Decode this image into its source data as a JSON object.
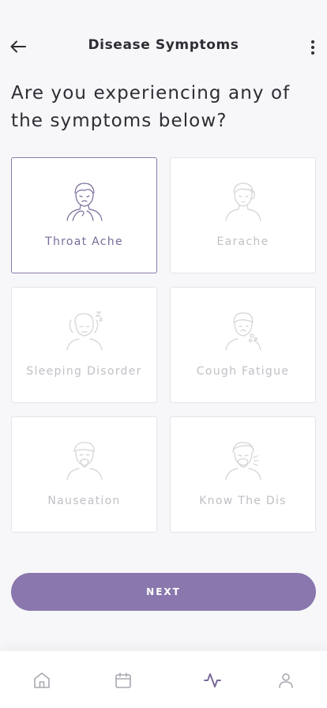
{
  "header": {
    "title": "Disease Symptoms"
  },
  "question": "Are you experiencing any of the symptoms below?",
  "symptoms": [
    {
      "label": "Throat Ache",
      "selected": true
    },
    {
      "label": "Earache",
      "selected": false
    },
    {
      "label": "Sleeping Disorder",
      "selected": false
    },
    {
      "label": "Cough Fatigue",
      "selected": false
    },
    {
      "label": "Nauseation",
      "selected": false
    },
    {
      "label": "Know The Dis",
      "selected": false
    }
  ],
  "next_label": "NEXT",
  "tabbar": {
    "items": [
      "home-icon",
      "calendar-icon",
      "activity-icon",
      "profile-icon"
    ],
    "active_index": 2
  },
  "colors": {
    "accent": "#8a77ad",
    "selected_border": "#8c79ad",
    "muted_text": "#c0c0c6",
    "background": "#f7f7f9"
  }
}
